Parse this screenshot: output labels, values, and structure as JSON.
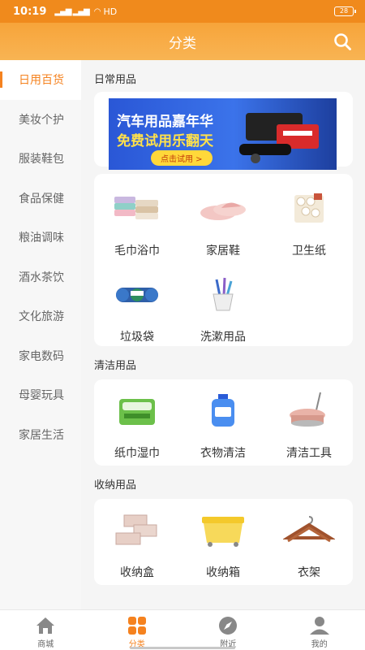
{
  "status_bar": {
    "time": "10:19",
    "signal": "HD",
    "battery": "28"
  },
  "header": {
    "title": "分类"
  },
  "sidebar": {
    "items": [
      {
        "label": "日用百货"
      },
      {
        "label": "美妆个护"
      },
      {
        "label": "服装鞋包"
      },
      {
        "label": "食品保健"
      },
      {
        "label": "粮油调味"
      },
      {
        "label": "酒水茶饮"
      },
      {
        "label": "文化旅游"
      },
      {
        "label": "家电数码"
      },
      {
        "label": "母婴玩具"
      },
      {
        "label": "家居生活"
      }
    ]
  },
  "sections": [
    {
      "title": "日常用品",
      "banner": {
        "line1": "汽车用品嘉年华",
        "line2": "免费试用乐翻天",
        "cta": "点击试用 >"
      },
      "items": [
        {
          "label": "毛巾浴巾",
          "icon": "towel-icon"
        },
        {
          "label": "家居鞋",
          "icon": "slipper-icon"
        },
        {
          "label": "卫生纸",
          "icon": "toilet-paper-icon"
        },
        {
          "label": "垃圾袋",
          "icon": "trash-bag-icon"
        },
        {
          "label": "洗漱用品",
          "icon": "toothbrush-cup-icon"
        }
      ]
    },
    {
      "title": "清洁用品",
      "items": [
        {
          "label": "纸巾湿巾",
          "icon": "tissue-icon"
        },
        {
          "label": "衣物清洁",
          "icon": "detergent-icon"
        },
        {
          "label": "清洁工具",
          "icon": "mop-bucket-icon"
        }
      ]
    },
    {
      "title": "收纳用品",
      "items": [
        {
          "label": "收纳盒",
          "icon": "storage-box-icon"
        },
        {
          "label": "收纳箱",
          "icon": "storage-bin-icon"
        },
        {
          "label": "衣架",
          "icon": "hanger-icon"
        }
      ]
    }
  ],
  "tabbar": {
    "items": [
      {
        "label": "商城",
        "icon": "home-icon"
      },
      {
        "label": "分类",
        "icon": "category-icon"
      },
      {
        "label": "附近",
        "icon": "compass-icon"
      },
      {
        "label": "我的",
        "icon": "user-icon"
      }
    ]
  },
  "colors": {
    "accent": "#f5821f",
    "header": "#f7a43a"
  }
}
